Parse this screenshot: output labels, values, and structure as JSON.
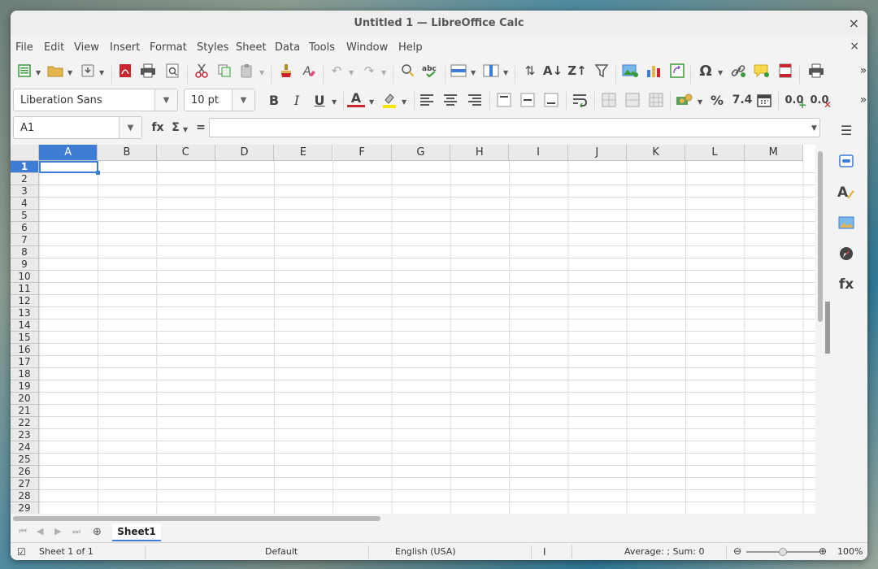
{
  "window": {
    "title": "Untitled 1 — LibreOffice Calc",
    "close": "×"
  },
  "menu": {
    "items": [
      "File",
      "Edit",
      "View",
      "Insert",
      "Format",
      "Styles",
      "Sheet",
      "Data",
      "Tools",
      "Window",
      "Help"
    ],
    "close": "×"
  },
  "toolbar": {
    "overflow": "»"
  },
  "formatting": {
    "font_name": "Liberation Sans",
    "font_size": "10 pt",
    "bold": "B",
    "italic": "I",
    "underline": "U",
    "font_color_glyph": "A",
    "percent": "%",
    "number_format": "7.4",
    "add_decimal": "0.0",
    "delete_decimal": "0.0"
  },
  "formula_bar": {
    "name_box": "A1",
    "function_wizard": "fx",
    "sum": "Σ",
    "equals": "=",
    "value": ""
  },
  "columns": [
    "A",
    "B",
    "C",
    "D",
    "E",
    "F",
    "G",
    "H",
    "I",
    "J",
    "K",
    "L",
    "M"
  ],
  "rows": [
    "1",
    "2",
    "3",
    "4",
    "5",
    "6",
    "7",
    "8",
    "9",
    "10",
    "11",
    "12",
    "13",
    "14",
    "15",
    "16",
    "17",
    "18",
    "19",
    "20",
    "21",
    "22",
    "23",
    "24",
    "25",
    "26",
    "27",
    "28",
    "29"
  ],
  "selected_cell": "A1",
  "sheets": {
    "tabs": [
      "Sheet1"
    ],
    "active": "Sheet1"
  },
  "status": {
    "sheet_info": "Sheet 1 of 1",
    "page_style": "Default",
    "language": "English (USA)",
    "summary": "Average: ; Sum: 0",
    "zoom": "100%",
    "zoom_out": "⊖",
    "zoom_in": "⊕"
  },
  "colors": {
    "accent": "#3d7dd6",
    "header_bg": "#eaeaea",
    "window_bg": "#f3f3f3"
  }
}
